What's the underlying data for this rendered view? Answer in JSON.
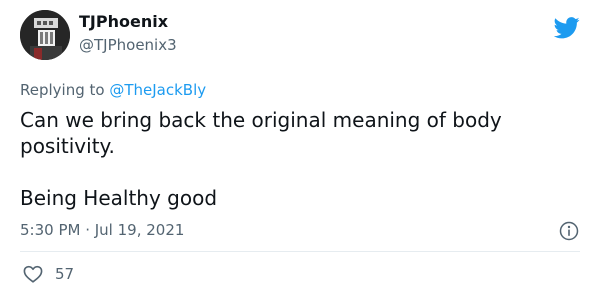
{
  "author": {
    "display_name": "TJPhoenix",
    "handle": "@TJPhoenix3"
  },
  "reply_context": {
    "prefix": "Replying to",
    "mention": "@TheJackBly"
  },
  "tweet": {
    "text_line_1": "Can we bring back the original meaning of body positivity.",
    "text_line_2": "Being Healthy good",
    "timestamp": "5:30 PM · Jul 19, 2021"
  },
  "actions": {
    "like_count": "57"
  },
  "icons": {
    "brand": "twitter-bird-icon",
    "info": "info-icon",
    "like": "heart-icon"
  },
  "colors": {
    "brand_blue": "#1d9bf0",
    "secondary_text": "#536471",
    "primary_text": "#0f1419"
  }
}
